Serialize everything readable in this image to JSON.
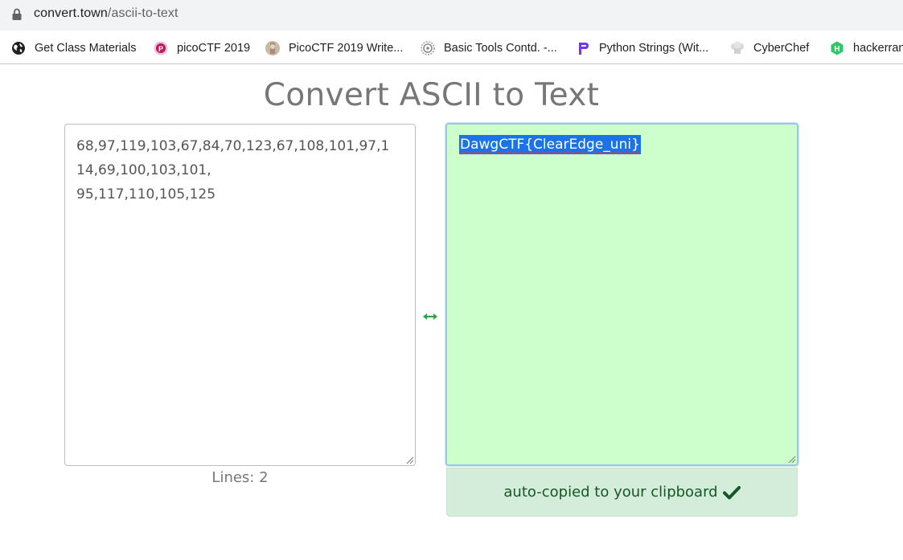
{
  "browser": {
    "url_host": "convert.town",
    "url_path": "/ascii-to-text"
  },
  "bookmarks": [
    {
      "label": "Get Class Materials",
      "icon": "globe-icon"
    },
    {
      "label": "picoCTF 2019",
      "icon": "picoctf-icon"
    },
    {
      "label": "PicoCTF 2019 Write...",
      "icon": "avatar-icon"
    },
    {
      "label": "Basic Tools Contd. -...",
      "icon": "gear-icon"
    },
    {
      "label": "Python Strings (Wit...",
      "icon": "python-strings-icon"
    },
    {
      "label": "CyberChef",
      "icon": "chef-hat-icon"
    },
    {
      "label": "hackerrank",
      "icon": "hackerrank-icon"
    }
  ],
  "page": {
    "title": "Convert ASCII to Text",
    "input_lines": [
      "68,97,119,103,67,84,70,123,67,108,101,97,1",
      "14,69,100,103,101,",
      "95,117,110,105,125"
    ],
    "lines_count": "Lines: 2",
    "output_text": "DawgCTF{ClearEdge_uni}",
    "copied_message": "auto-copied to your clipboard"
  },
  "colors": {
    "output_bg": "#ccffcc",
    "selection": "#1a73e8",
    "copied_bg": "#d4edda",
    "copied_text": "#155724",
    "swap_arrow": "#28a745"
  }
}
